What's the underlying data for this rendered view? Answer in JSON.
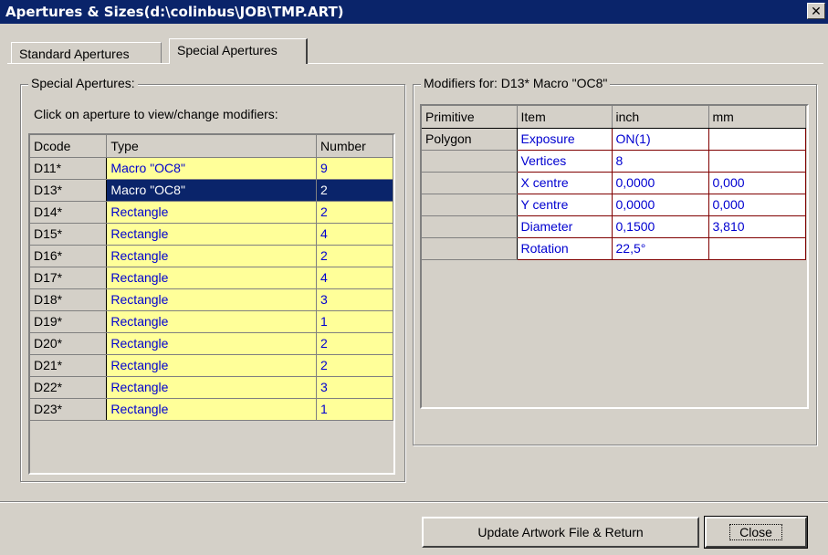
{
  "window": {
    "title": "Apertures & Sizes(d:\\colinbus\\JOB\\TMP.ART)",
    "close_glyph": "✕"
  },
  "tabs": [
    {
      "label": "Standard Apertures"
    },
    {
      "label": "Special Apertures"
    }
  ],
  "left_group": {
    "title": "Special Apertures:",
    "hint": "Click on aperture to view/change modifiers:",
    "columns": [
      "Dcode",
      "Type",
      "Number"
    ],
    "rows": [
      {
        "dcode": "D11*",
        "type": "Macro \"OC8\"",
        "number": "9"
      },
      {
        "dcode": "D13*",
        "type": "Macro \"OC8\"",
        "number": "2"
      },
      {
        "dcode": "D14*",
        "type": "Rectangle",
        "number": "2"
      },
      {
        "dcode": "D15*",
        "type": "Rectangle",
        "number": "4"
      },
      {
        "dcode": "D16*",
        "type": "Rectangle",
        "number": "2"
      },
      {
        "dcode": "D17*",
        "type": "Rectangle",
        "number": "4"
      },
      {
        "dcode": "D18*",
        "type": "Rectangle",
        "number": "3"
      },
      {
        "dcode": "D19*",
        "type": "Rectangle",
        "number": "1"
      },
      {
        "dcode": "D20*",
        "type": "Rectangle",
        "number": "2"
      },
      {
        "dcode": "D21*",
        "type": "Rectangle",
        "number": "2"
      },
      {
        "dcode": "D22*",
        "type": "Rectangle",
        "number": "3"
      },
      {
        "dcode": "D23*",
        "type": "Rectangle",
        "number": "1"
      }
    ]
  },
  "right_group": {
    "title": "Modifiers for: D13* Macro \"OC8\"",
    "columns": [
      "Primitive",
      "Item",
      "inch",
      "mm"
    ],
    "rows": [
      {
        "primitive": "Polygon",
        "item": "Exposure",
        "inch": "ON(1)",
        "mm": ""
      },
      {
        "primitive": "",
        "item": "Vertices",
        "inch": "8",
        "mm": ""
      },
      {
        "primitive": "",
        "item": "X centre",
        "inch": "0,0000",
        "mm": "0,000"
      },
      {
        "primitive": "",
        "item": "Y centre",
        "inch": "0,0000",
        "mm": "0,000"
      },
      {
        "primitive": "",
        "item": "Diameter",
        "inch": "0,1500",
        "mm": "3,810"
      },
      {
        "primitive": "",
        "item": "Rotation",
        "inch": "22,5°",
        "mm": ""
      }
    ]
  },
  "buttons": {
    "update": "Update Artwork File & Return",
    "close": "Close"
  }
}
